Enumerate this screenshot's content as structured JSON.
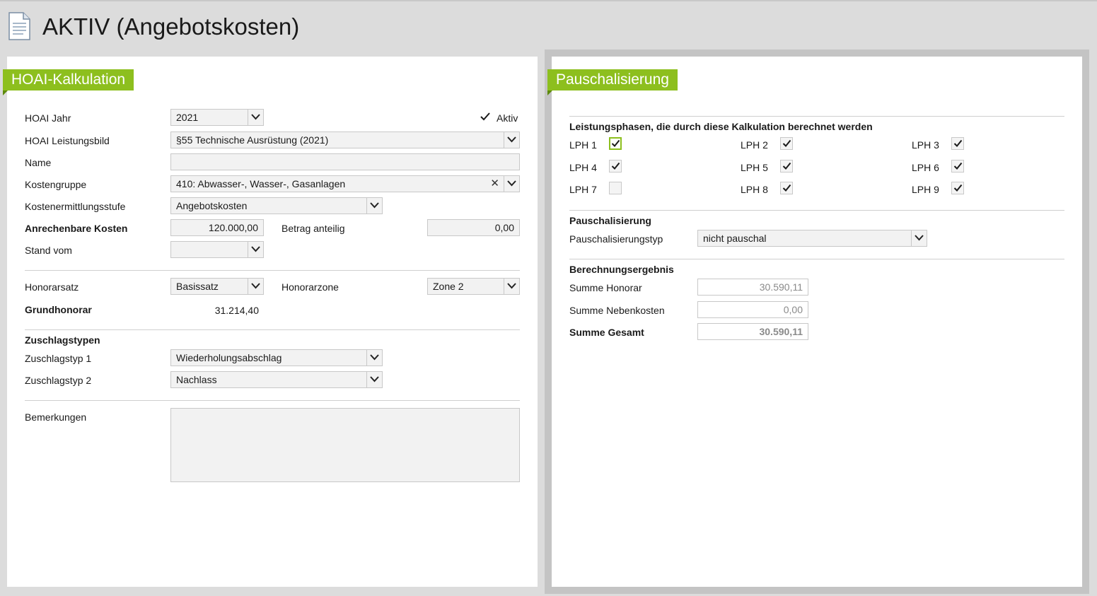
{
  "page": {
    "title": "AKTIV (Angebotskosten)",
    "icon": "document-icon"
  },
  "left_panel": {
    "section_title": "HOAI-Kalkulation",
    "hoai_jahr": {
      "label": "HOAI Jahr",
      "value": "2021"
    },
    "aktiv": {
      "label": "Aktiv",
      "checked": true
    },
    "leistungsbild": {
      "label": "HOAI Leistungsbild",
      "value": "§55 Technische Ausrüstung (2021)"
    },
    "name": {
      "label": "Name",
      "value": ""
    },
    "kostengruppe": {
      "label": "Kostengruppe",
      "value": "410: Abwasser-, Wasser-, Gasanlagen",
      "clear_icon": "close-icon"
    },
    "kostenermittlungsstufe": {
      "label": "Kostenermittlungsstufe",
      "value": "Angebotskosten"
    },
    "anrechenbare_kosten": {
      "label": "Anrechenbare Kosten",
      "value": "120.000,00"
    },
    "betrag_anteilig": {
      "label": "Betrag anteilig",
      "value": "0,00"
    },
    "stand_vom": {
      "label": "Stand vom",
      "value": ""
    },
    "honorarsatz": {
      "label": "Honorarsatz",
      "value": "Basissatz"
    },
    "honorarzone": {
      "label": "Honorarzone",
      "value": "Zone 2"
    },
    "grundhonorar": {
      "label": "Grundhonorar",
      "value": "31.214,40"
    },
    "zuschlagstypen_header": "Zuschlagstypen",
    "zuschlagstyp1": {
      "label": "Zuschlagstyp 1",
      "value": "Wiederholungsabschlag"
    },
    "zuschlagstyp2": {
      "label": "Zuschlagstyp 2",
      "value": "Nachlass"
    },
    "bemerkungen": {
      "label": "Bemerkungen",
      "value": ""
    }
  },
  "right_panel": {
    "section_title": "Pauschalisierung",
    "lph_header": "Leistungsphasen, die durch diese Kalkulation berechnet werden",
    "lph": [
      {
        "label": "LPH 1",
        "checked": true
      },
      {
        "label": "LPH 2",
        "checked": true
      },
      {
        "label": "LPH 3",
        "checked": true
      },
      {
        "label": "LPH 4",
        "checked": true
      },
      {
        "label": "LPH 5",
        "checked": true
      },
      {
        "label": "LPH 6",
        "checked": true
      },
      {
        "label": "LPH 7",
        "checked": false
      },
      {
        "label": "LPH 8",
        "checked": true
      },
      {
        "label": "LPH 9",
        "checked": true
      }
    ],
    "pauschalisierung_header": "Pauschalisierung",
    "pauschalisierungstyp": {
      "label": "Pauschalisierungstyp",
      "value": "nicht pauschal"
    },
    "ergebnis_header": "Berechnungsergebnis",
    "summe_honorar": {
      "label": "Summe Honorar",
      "value": "30.590,11"
    },
    "summe_nebenkosten": {
      "label": "Summe Nebenkosten",
      "value": "0,00"
    },
    "summe_gesamt": {
      "label": "Summe Gesamt",
      "value": "30.590,11"
    }
  },
  "colors": {
    "accent": "#8dbf1e",
    "accent_dark": "#5d8a0c",
    "background": "#dcdcdc",
    "field_bg": "#f2f2f2"
  }
}
